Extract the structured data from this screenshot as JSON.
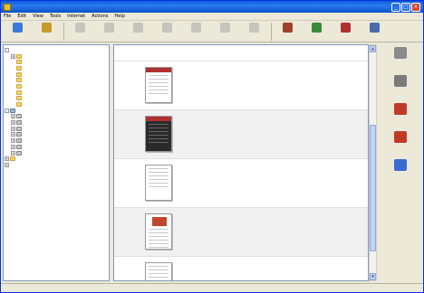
{
  "window": {
    "title": "",
    "min_glyph": "_",
    "max_glyph": "□",
    "close_glyph": "×"
  },
  "menu": [
    {
      "label": "File"
    },
    {
      "label": "Edit"
    },
    {
      "label": "View"
    },
    {
      "label": "Tools"
    },
    {
      "label": "Internet"
    },
    {
      "label": "Actions"
    },
    {
      "label": "Help"
    }
  ],
  "toolbar": [
    {
      "label": "",
      "icon": "search-icon",
      "color": "#3b7ad8",
      "disabled": false
    },
    {
      "label": "",
      "icon": "open-icon",
      "color": "#c79a2a",
      "disabled": false
    },
    {
      "label": "",
      "icon": "print-icon",
      "color": "#999999",
      "disabled": true
    },
    {
      "label": "",
      "icon": "preview-icon",
      "color": "#999999",
      "disabled": true
    },
    {
      "label": "",
      "icon": "copy-icon",
      "color": "#999999",
      "disabled": true
    },
    {
      "label": "",
      "icon": "paste-icon",
      "color": "#999999",
      "disabled": true
    },
    {
      "label": "",
      "icon": "delete-icon",
      "color": "#999999",
      "disabled": true
    },
    {
      "label": "",
      "icon": "email-icon",
      "color": "#999999",
      "disabled": true
    },
    {
      "label": "",
      "icon": "stop-icon",
      "color": "#999999",
      "disabled": true
    },
    {
      "label": "",
      "icon": "desktop-icon",
      "color": "#a0422a",
      "disabled": false
    },
    {
      "label": "",
      "icon": "network-icon",
      "color": "#3a8a3a",
      "disabled": false
    },
    {
      "label": "",
      "icon": "computer-icon",
      "color": "#b03030",
      "disabled": false
    },
    {
      "label": "",
      "icon": "settings-icon",
      "color": "#4a6aa8",
      "disabled": false
    }
  ],
  "tree": [
    {
      "label": "",
      "depth": 0,
      "exp": "-",
      "icon": "desktop",
      "selected": false
    },
    {
      "label": "",
      "depth": 1,
      "exp": "+",
      "icon": "folder",
      "selected": false
    },
    {
      "label": "",
      "depth": 1,
      "exp": "",
      "icon": "folder",
      "selected": false
    },
    {
      "label": "",
      "depth": 1,
      "exp": "",
      "icon": "folder",
      "selected": false
    },
    {
      "label": "",
      "depth": 1,
      "exp": "",
      "icon": "folder",
      "selected": false
    },
    {
      "label": "",
      "depth": 1,
      "exp": "",
      "icon": "folder",
      "selected": false
    },
    {
      "label": "",
      "depth": 1,
      "exp": "",
      "icon": "folder",
      "selected": false
    },
    {
      "label": "",
      "depth": 1,
      "exp": "",
      "icon": "folder",
      "selected": false
    },
    {
      "label": "",
      "depth": 1,
      "exp": "",
      "icon": "folder",
      "selected": false
    },
    {
      "label": "",
      "depth": 1,
      "exp": "",
      "icon": "folder",
      "selected": false
    },
    {
      "label": "",
      "depth": 0,
      "exp": "-",
      "icon": "pc",
      "selected": false
    },
    {
      "label": "",
      "depth": 1,
      "exp": "+",
      "icon": "drive",
      "selected": false
    },
    {
      "label": "",
      "depth": 1,
      "exp": "+",
      "icon": "drive",
      "selected": false
    },
    {
      "label": "",
      "depth": 1,
      "exp": "+",
      "icon": "drive",
      "selected": false
    },
    {
      "label": "",
      "depth": 1,
      "exp": "+",
      "icon": "drive",
      "selected": false
    },
    {
      "label": "",
      "depth": 1,
      "exp": "+",
      "icon": "drive",
      "selected": false
    },
    {
      "label": "",
      "depth": 1,
      "exp": "+",
      "icon": "drive",
      "selected": false
    },
    {
      "label": "",
      "depth": 1,
      "exp": "+",
      "icon": "drive",
      "selected": false
    },
    {
      "label": "",
      "depth": 0,
      "exp": "+",
      "icon": "folder",
      "selected": false
    },
    {
      "label": "",
      "depth": 0,
      "exp": "+",
      "icon": "desktop",
      "selected": false
    }
  ],
  "results": [
    {
      "kind": "top",
      "type_label": "",
      "type_value": ""
    },
    {
      "thumb": "pages",
      "score_label": "",
      "score": "",
      "title": "",
      "location": "",
      "type": "",
      "size": "",
      "modified_label": "",
      "modified": ""
    },
    {
      "thumb": "dark",
      "score_label": "",
      "score": "",
      "title": "",
      "location": "",
      "type": "",
      "size": "",
      "modified_label": "",
      "modified": ""
    },
    {
      "thumb": "plain",
      "score_label": "",
      "score": "",
      "title": "",
      "location": "",
      "type": "",
      "size": "",
      "modified_label": "",
      "modified": ""
    },
    {
      "thumb": "image",
      "score_label": "",
      "score": "",
      "title": "",
      "location": "",
      "type": "",
      "size": "",
      "modified_label": "",
      "modified": ""
    },
    {
      "thumb": "plain",
      "score_label": "",
      "score": "",
      "title": "",
      "location": "",
      "type": "",
      "size": "",
      "modified_label": "",
      "modified": ""
    }
  ],
  "actions": [
    {
      "label": "",
      "icon": "print-icon",
      "color": "#8a8a8a"
    },
    {
      "label": "",
      "icon": "email-icon",
      "color": "#7a7a7a"
    },
    {
      "label": "",
      "icon": "document-icon",
      "color": "#c03a2a"
    },
    {
      "label": "",
      "icon": "convert-icon",
      "color": "#c03a2a"
    },
    {
      "label": "",
      "icon": "web-icon",
      "color": "#3a6ad0"
    }
  ],
  "status": {
    "text": ""
  }
}
